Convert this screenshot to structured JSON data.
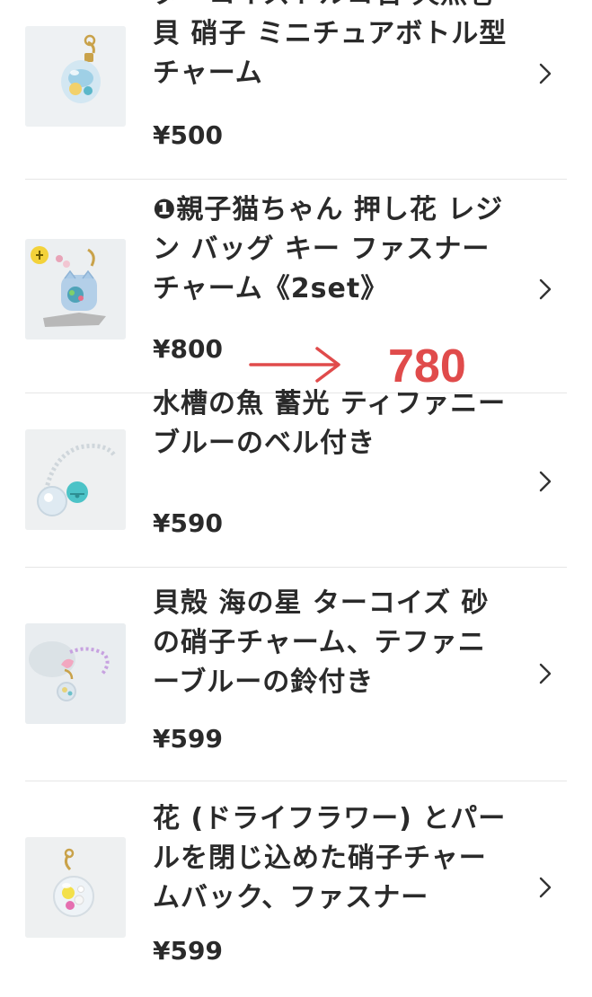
{
  "currency_symbol": "¥",
  "items": [
    {
      "title": "ターコイズトルコ石 天然巻貝 硝子 ミニチュアボトル型チャーム",
      "price": "¥500",
      "thumbnail": "bottle-charm-image"
    },
    {
      "title": "❶親子猫ちゃん 押し花 レジン バッグ キー ファスナー チャーム《2set》",
      "price": "¥800",
      "thumbnail": "cat-charm-image"
    },
    {
      "title": "水槽の魚 蓄光 ティファニーブルーのベル付き",
      "price": "¥590",
      "thumbnail": "bell-charm-image"
    },
    {
      "title": "貝殻 海の星 ターコイズ 砂の硝子チャーム、テファニーブルーの鈴付き",
      "price": "¥599",
      "thumbnail": "shell-charm-image"
    },
    {
      "title": "花 (ドライフラワー) とパールを閉じ込めた硝子チャームバック、ファスナー",
      "price": "¥599",
      "thumbnail": "flower-charm-image"
    }
  ],
  "annotation": {
    "new_price": "780",
    "color": "#e04b4b",
    "icon": "right-arrow-icon"
  },
  "colors": {
    "text": "#2a2a2a",
    "divider": "#e6e6e6",
    "chevron": "#333333"
  }
}
